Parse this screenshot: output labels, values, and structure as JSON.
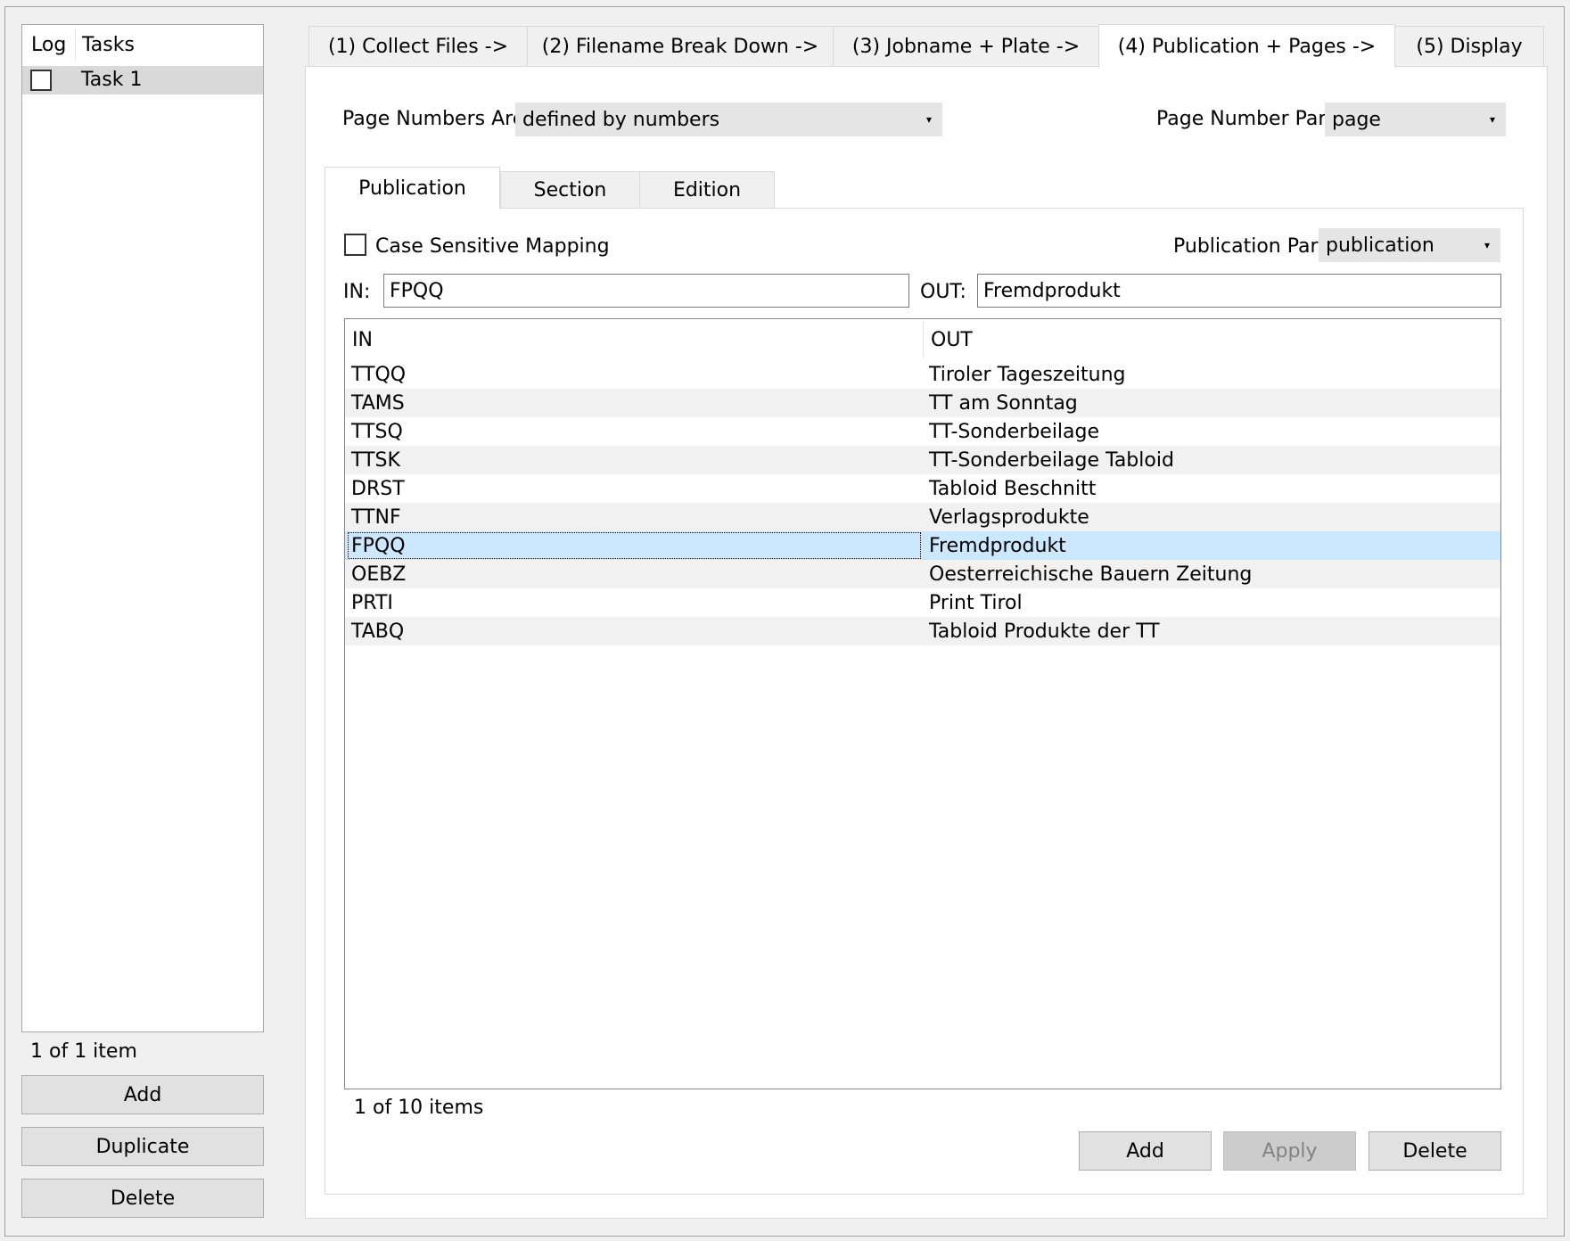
{
  "tasks": {
    "header_log": "Log",
    "header_tasks": "Tasks",
    "items": [
      {
        "label": "Task 1",
        "checked": false
      }
    ],
    "count": "1 of 1 item",
    "add_label": "Add",
    "duplicate_label": "Duplicate",
    "delete_label": "Delete"
  },
  "main_tabs": [
    {
      "label": "(1) Collect Files ->"
    },
    {
      "label": "(2) Filename Break Down ->"
    },
    {
      "label": "(3) Jobname + Plate ->"
    },
    {
      "label": "(4) Publication + Pages ->",
      "active": true
    },
    {
      "label": "(5) Display"
    }
  ],
  "page_numbers": {
    "label": "Page Numbers Are",
    "value": "defined by numbers",
    "part_label": "Page Number Part",
    "part_value": "page"
  },
  "sub_tabs": [
    {
      "label": "Publication",
      "active": true
    },
    {
      "label": "Section"
    },
    {
      "label": "Edition"
    }
  ],
  "publication": {
    "case_sensitive_label": "Case Sensitive Mapping",
    "case_sensitive_checked": false,
    "part_label": "Publication Part",
    "part_value": "publication",
    "in_label": "IN:",
    "in_value": "FPQQ",
    "out_label": "OUT:",
    "out_value": "Fremdprodukt",
    "table_header_in": "IN",
    "table_header_out": "OUT",
    "rows": [
      {
        "in": "TTQQ",
        "out": "Tiroler Tageszeitung"
      },
      {
        "in": "TAMS",
        "out": "TT am Sonntag"
      },
      {
        "in": "TTSQ",
        "out": "TT-Sonderbeilage"
      },
      {
        "in": "TTSK",
        "out": "TT-Sonderbeilage Tabloid"
      },
      {
        "in": "DRST",
        "out": "Tabloid Beschnitt"
      },
      {
        "in": "TTNF",
        "out": "Verlagsprodukte"
      },
      {
        "in": "FPQQ",
        "out": "Fremdprodukt",
        "selected": true
      },
      {
        "in": "OEBZ",
        "out": "Oesterreichische Bauern Zeitung"
      },
      {
        "in": "PRTI",
        "out": "Print Tirol"
      },
      {
        "in": "TABQ",
        "out": "Tabloid Produkte der TT"
      }
    ],
    "count": "1 of 10 items",
    "add_label": "Add",
    "apply_label": "Apply",
    "delete_label": "Delete"
  }
}
